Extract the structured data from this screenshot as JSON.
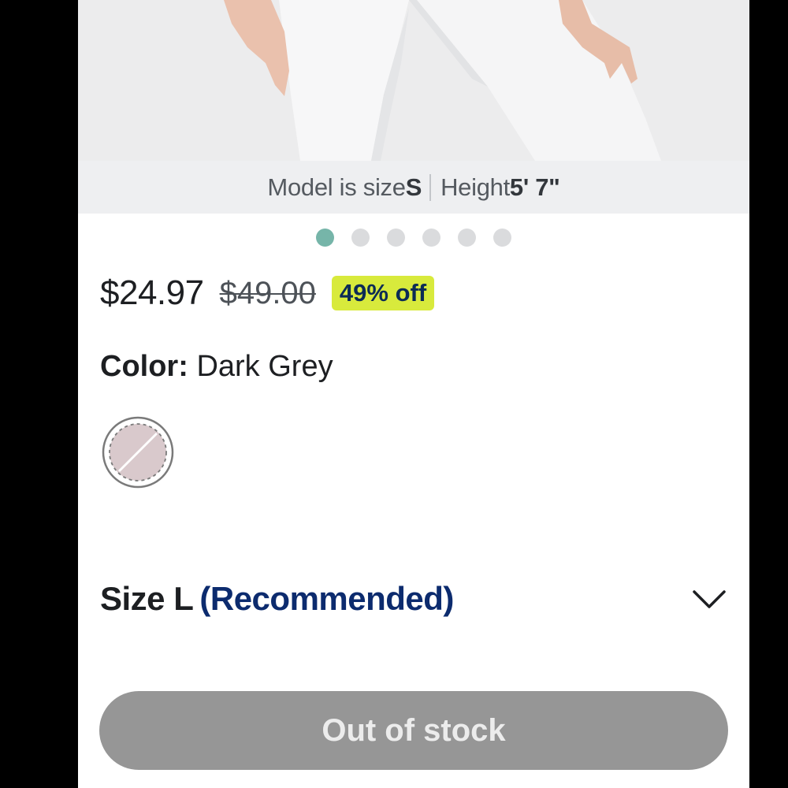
{
  "product_image": {
    "description": "model-photo"
  },
  "model_info": {
    "prefix": "Model is size ",
    "size": "S",
    "height_label": "Height ",
    "height": "5' 7\""
  },
  "carousel": {
    "count": 6,
    "active_index": 0
  },
  "pricing": {
    "current": "$24.97",
    "original": "$49.00",
    "discount": "49% off"
  },
  "color": {
    "label": "Color:",
    "value": "Dark Grey",
    "swatch_color": "#d9c9cc",
    "swatch_unavailable": true
  },
  "size": {
    "label": "Size L",
    "recommendation": "(Recommended)"
  },
  "action_button": {
    "label": "Out of stock",
    "disabled": true
  },
  "colors": {
    "accent_teal": "#76b5a9",
    "badge_bg": "#d8ea3c",
    "badge_text": "#0c2b55",
    "recommended_text": "#0c2b6e",
    "button_bg": "#969696"
  }
}
